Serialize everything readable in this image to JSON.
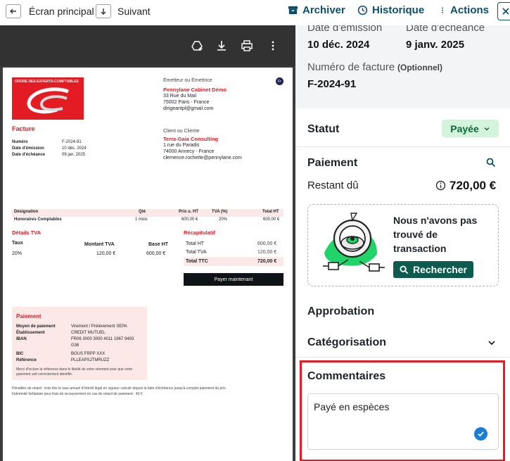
{
  "topbar": {
    "back_icon": "arrow-left-icon",
    "home_label": "Écran principal",
    "next_icon": "arrow-down-icon",
    "next_label": "Suivant",
    "archive_label": "Archiver",
    "history_label": "Historique",
    "actions_label": "Actions",
    "close_icon": "close-icon"
  },
  "pdf": {
    "logo_text": "ORDRE DES EXPERTS-COMPTABLES",
    "emitter_title": "Émetteur ou Émettrice",
    "emitter_name": "Pennylane Cabinet Démo",
    "emitter_address1": "33 Rue du Mail",
    "emitter_address2": "75002 Paris - France",
    "emitter_email": "dirigeantpl@gmail.com",
    "avatar_text": "Fr",
    "client_title": "Client ou Cliente",
    "client_name": "Terra-Gaia Consulting",
    "client_address1": "1 rue du Paradis",
    "client_address2": "74000 Annecy - France",
    "client_email": "clemence.rochette@pennylane.com",
    "invoice_title": "Facture",
    "meta": [
      {
        "label": "Numéro",
        "value": "F-2024-91"
      },
      {
        "label": "Date d'émission",
        "value": "10 déc. 2024"
      },
      {
        "label": "Date d'échéance",
        "value": "09 jan. 2025"
      }
    ],
    "table_headers": [
      "Désignation",
      "Qté",
      "Prix u. HT",
      "TVA (%)",
      "Total HT"
    ],
    "table_row": [
      "Honoraires Comptables",
      "1 mois",
      "600,00 €",
      "20%",
      "600,00 €"
    ],
    "vat_title": "Détails TVA",
    "vat_headers": [
      "Taux",
      "Montant TVA",
      "Base HT"
    ],
    "vat_row": [
      "20%",
      "120,00 €",
      "600,00 €"
    ],
    "summary_title": "Récapitulatif",
    "summary": [
      {
        "label": "Total HT",
        "value": "600,00 €"
      },
      {
        "label": "Total TVA",
        "value": "120,00 €"
      },
      {
        "label": "Total TTC",
        "value": "720,00 €"
      }
    ],
    "pay_now": "Payer maintenant",
    "payment_title": "Paiement",
    "payment_rows": [
      {
        "label": "Moyen de paiement",
        "value": "Virement / Prélèvement SEPA"
      },
      {
        "label": "Établissement",
        "value": "CREDIT MUTUEL"
      },
      {
        "label": "IBAN",
        "value": "FR06 3000 3000 4011 1967 9493"
      },
      {
        "label": "",
        "value": "G36"
      },
      {
        "label": "BIC",
        "value": "BOUS FRPP XXX"
      },
      {
        "label": "Référence",
        "value": "PLLEAPSJTMRUZZ"
      }
    ],
    "payment_note1": "Merci d'inclure la référence dans le libellé de votre virement pour que votre",
    "payment_note2": "paiement soit correctement identifié.",
    "penalty1": "Pénalités de retard : trois fois le taux annuel d'intérêt légal en vigueur calculé depuis la date d'échéance jusqu'à complet paiement du prix.",
    "penalty2": "Indemnité forfaitaire pour frais de recouvrement en cas de retard de paiement : 40 €"
  },
  "panel": {
    "issue_date_label": "Date d'émission",
    "issue_date": "10 déc. 2024",
    "due_date_label": "Date d'échéance",
    "due_date": "9 janv. 2025",
    "invoice_number_label": "Numéro de facture",
    "invoice_number_optional": "(Optionnel)",
    "invoice_number": "F-2024-91",
    "status_title": "Statut",
    "status_value": "Payée",
    "payment_title": "Paiement",
    "remaining_label": "Restant dû",
    "remaining_value": "720,00 €",
    "tx_message": "Nous n'avons pas trouvé de transaction",
    "search_label": "Rechercher",
    "approval_title": "Approbation",
    "categorization_title": "Catégorisation",
    "comments_title": "Commentaires",
    "comment_text": "Payé en espèces"
  },
  "colors": {
    "accent": "#0b4f6c",
    "brand_red": "#e31b23",
    "status_green_bg": "#d4f3dc",
    "search_btn": "#0d5a4e",
    "highlight": "#e41b23"
  }
}
